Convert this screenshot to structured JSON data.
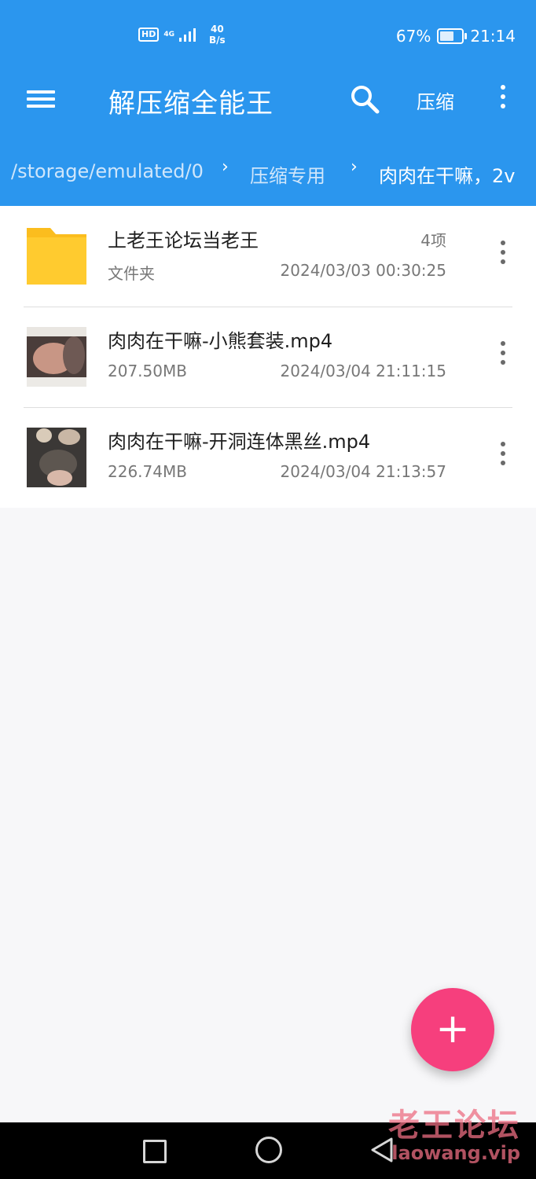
{
  "status_bar": {
    "hd": "HD",
    "network": "4G",
    "speed_value": "40",
    "speed_unit": "B/s",
    "battery_percent": "67%",
    "battery_level": 0.67,
    "time": "21:14"
  },
  "appbar": {
    "title": "解压缩全能王",
    "compress_label": "压缩",
    "menu_icon": "hamburger-menu-icon",
    "search_icon": "search-icon",
    "more_icon": "more-vertical-icon"
  },
  "breadcrumb": {
    "items": [
      "/storage/emulated/0",
      "压缩专用",
      "肉肉在干嘛，2v"
    ],
    "separator": "›"
  },
  "files": [
    {
      "name": "上老王论坛当老王",
      "subtitle": "文件夹",
      "count": "4项",
      "date": "2024/03/03 00:30:25",
      "type": "folder"
    },
    {
      "name": "肉肉在干嘛-小熊套装.mp4",
      "subtitle": "207.50MB",
      "date": "2024/03/04 21:11:15",
      "type": "video"
    },
    {
      "name": "肉肉在干嘛-开洞连体黑丝.mp4",
      "subtitle": "226.74MB",
      "date": "2024/03/04 21:13:57",
      "type": "video"
    }
  ],
  "fab": {
    "label": "+"
  },
  "watermark": {
    "title": "老王论坛",
    "url": "laowang.vip"
  },
  "colors": {
    "primary": "#2b96ee",
    "accent": "#f63f7d",
    "folder": "#ffcb2f"
  }
}
